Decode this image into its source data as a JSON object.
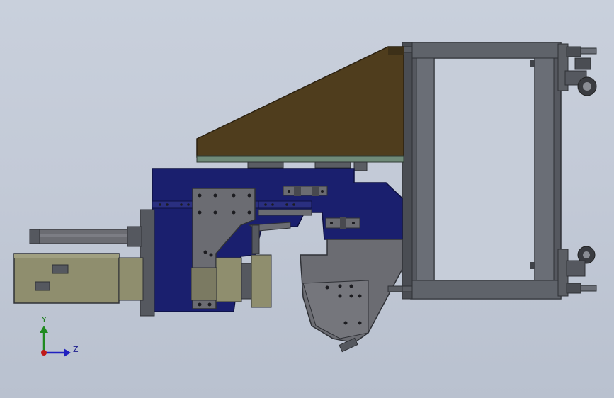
{
  "viewport": {
    "name": "graphics-area",
    "background_top": "#c9d0dc",
    "background_bottom": "#b9c1cf"
  },
  "model": {
    "colors": {
      "frame": "#55585f",
      "frame_dark": "#3f4248",
      "frame_light": "#6a6e76",
      "wood": "#4f3d1d",
      "plate_green": "#6f8a78",
      "navy": "#1a1f6e",
      "navy_dark": "#121656",
      "plate_gray": "#6b6c72",
      "motor": "#8f8e6e",
      "motor_dark": "#6f6e55",
      "hole": "#1c1c20"
    }
  },
  "triad": {
    "y_label": "Y",
    "z_label": "Z",
    "y_color": "#1f8a1f",
    "z_color": "#2020c0",
    "origin_color": "#c01818"
  }
}
